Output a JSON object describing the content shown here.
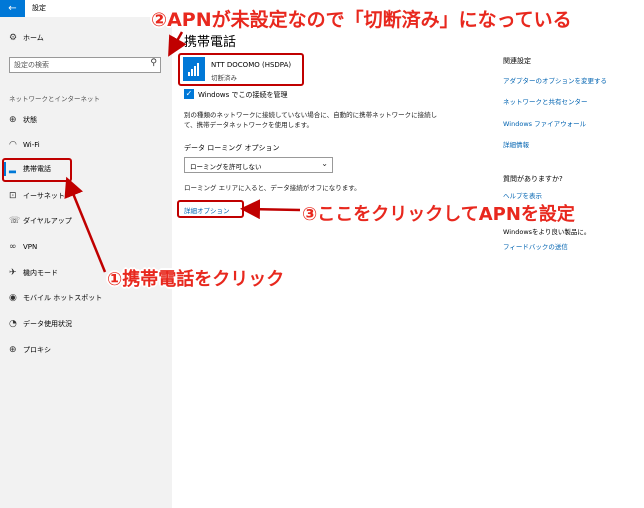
{
  "window": {
    "title": "設定",
    "back_icon": "back-arrow-icon"
  },
  "sidebar": {
    "home": {
      "label": "ホーム",
      "icon": "gear-icon"
    },
    "search_placeholder": "設定の検索",
    "section_label": "ネットワークとインターネット",
    "items": [
      {
        "label": "状態",
        "icon": "globe-icon"
      },
      {
        "label": "Wi-Fi",
        "icon": "wifi-icon"
      },
      {
        "label": "携帯電話",
        "icon": "signal-icon",
        "active": true
      },
      {
        "label": "イーサネット",
        "icon": "ethernet-icon"
      },
      {
        "label": "ダイヤルアップ",
        "icon": "phone-icon"
      },
      {
        "label": "VPN",
        "icon": "vpn-icon"
      },
      {
        "label": "機内モード",
        "icon": "airplane-icon"
      },
      {
        "label": "モバイル ホットスポット",
        "icon": "hotspot-icon"
      },
      {
        "label": "データ使用状況",
        "icon": "data-usage-icon"
      },
      {
        "label": "プロキシ",
        "icon": "globe-icon"
      }
    ]
  },
  "main": {
    "title": "携帯電話",
    "network": {
      "name": "NTT DOCOMO (HSDPA)",
      "status": "切断済み"
    },
    "manage_checkbox": {
      "label": "Windows でこの接続を管理",
      "checked": true
    },
    "description": "別の種類のネットワークに接続していない場合に、自動的に携帯ネットワークに接続して、携帯データネットワークを使用します。",
    "roaming_label": "データ ローミング オプション",
    "roaming_value": "ローミングを許可しない",
    "roaming_note": "ローミング エリアに入ると、データ接続がオフになります。",
    "advanced_link": "詳細オプション"
  },
  "related": {
    "heading": "関連設定",
    "links": [
      "アダプターのオプションを変更する",
      "ネットワークと共有センター",
      "Windows ファイアウォール",
      "詳細情報"
    ],
    "question": "質問がありますか?",
    "help_link": "ヘルプを表示",
    "improve_text": "Windowsをより良い製品に。",
    "feedback_link": "フィードバックの送信"
  },
  "annotations": {
    "step1": "①携帯電話をクリック",
    "step2": "②APNが未設定なので「切断済み」になっている",
    "step3": "③ここをクリックしてAPNを設定",
    "color": "#e8281e"
  },
  "colors": {
    "accent": "#0078d7",
    "annotation_box": "#c00000"
  }
}
